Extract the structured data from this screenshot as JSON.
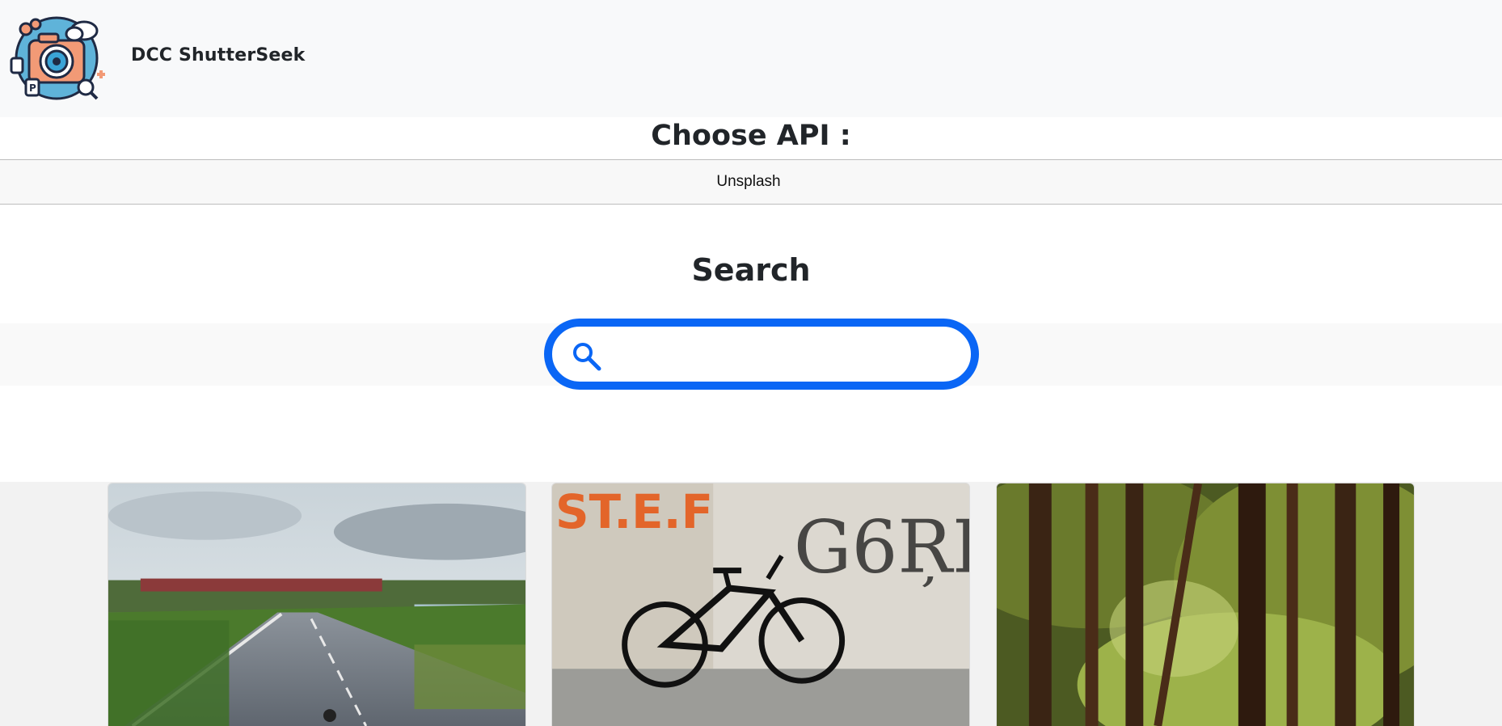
{
  "navbar": {
    "brand": "DCC ShutterSeek",
    "logo_icon": "camera-logo-icon"
  },
  "api_section": {
    "title": "Choose API :",
    "selected": "Unsplash"
  },
  "search_section": {
    "title": "Search",
    "input_value": "",
    "placeholder": "",
    "icon": "search-icon",
    "accent_color": "#0a66f5"
  },
  "results": {
    "images": [
      {
        "description_icon": "road-photo"
      },
      {
        "description_icon": "bicycle-graffiti-photo"
      },
      {
        "description_icon": "forest-trees-photo"
      }
    ]
  }
}
